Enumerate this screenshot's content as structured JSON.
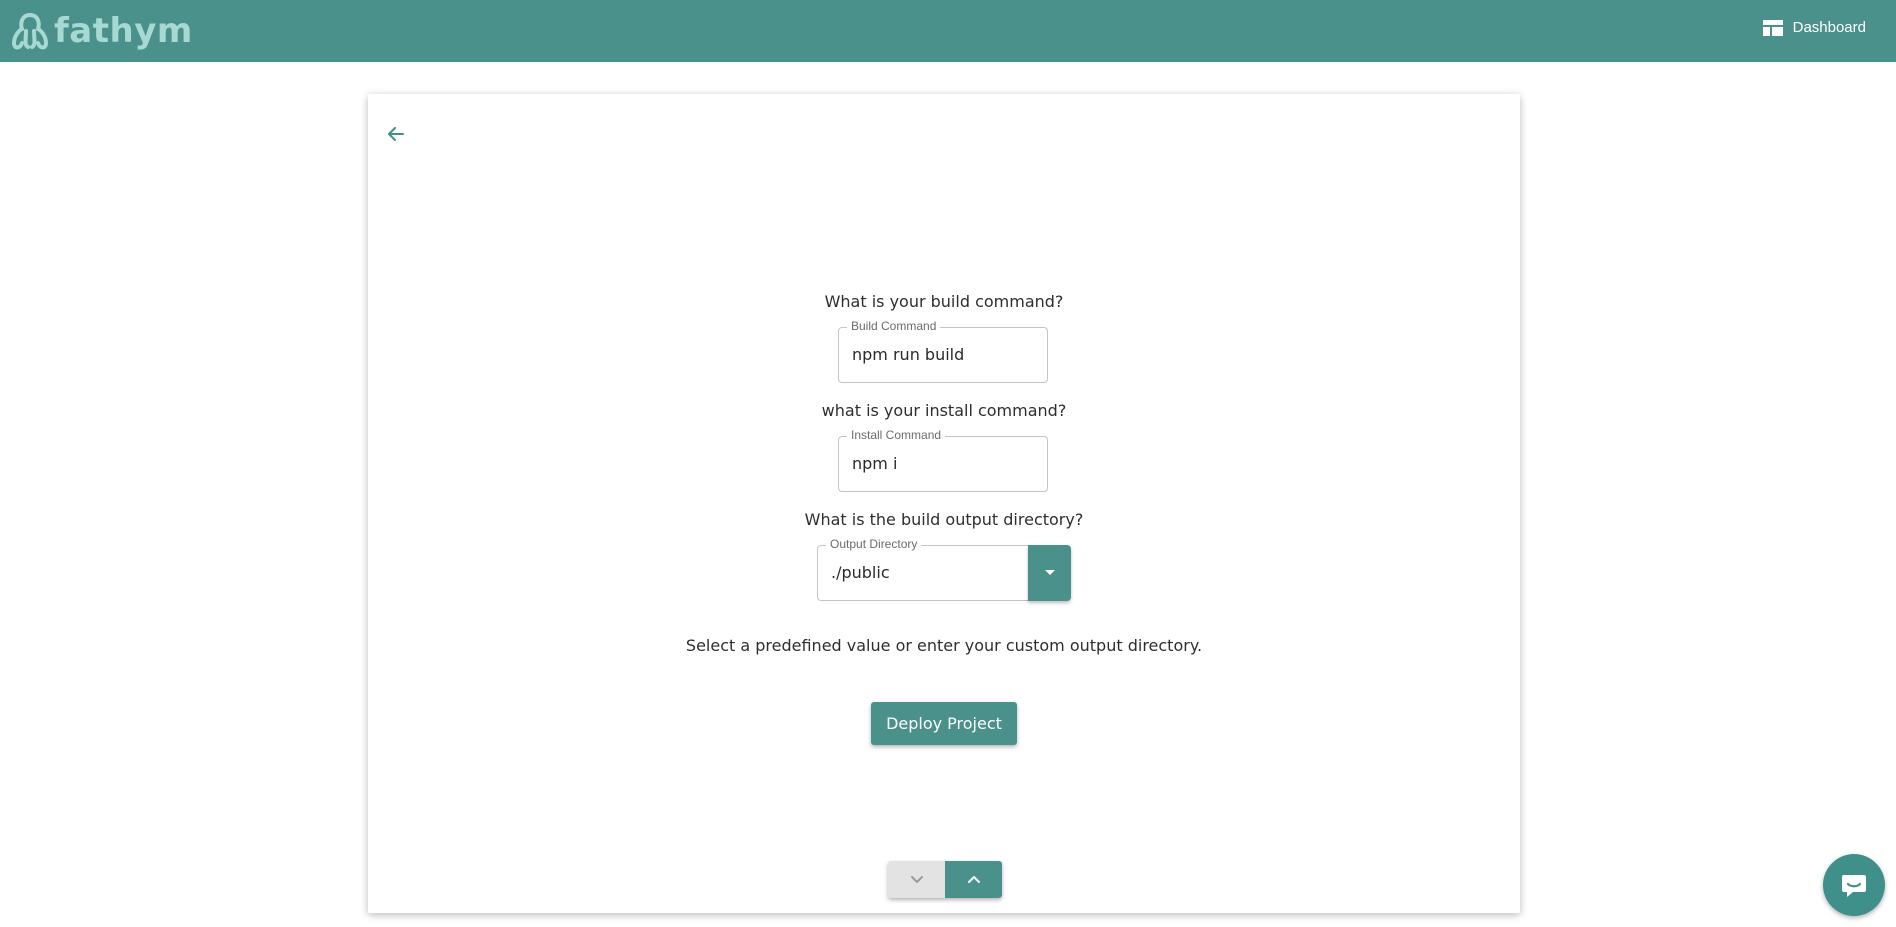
{
  "app": {
    "logo_text": "fathym",
    "brand_color": "#4a918c"
  },
  "header": {
    "dashboard_label": "Dashboard",
    "dashboard_icon": "dashboard-icon"
  },
  "form": {
    "back_icon": "arrow-left-icon",
    "build": {
      "question": "What is your build command?",
      "label": "Build Command",
      "value": "npm run build"
    },
    "install": {
      "question": "what is your install command?",
      "label": "Install Command",
      "value": "npm i"
    },
    "output": {
      "question": "What is the build output directory?",
      "label": "Output Directory",
      "value": "./public",
      "dropdown_icon": "caret-down-icon"
    },
    "hint": "Select a predefined value or enter your custom output directory.",
    "deploy_label": "Deploy Project"
  },
  "stepper": {
    "down_icon": "chevron-down-icon",
    "up_icon": "chevron-up-icon"
  },
  "chat": {
    "icon": "chat-icon"
  }
}
